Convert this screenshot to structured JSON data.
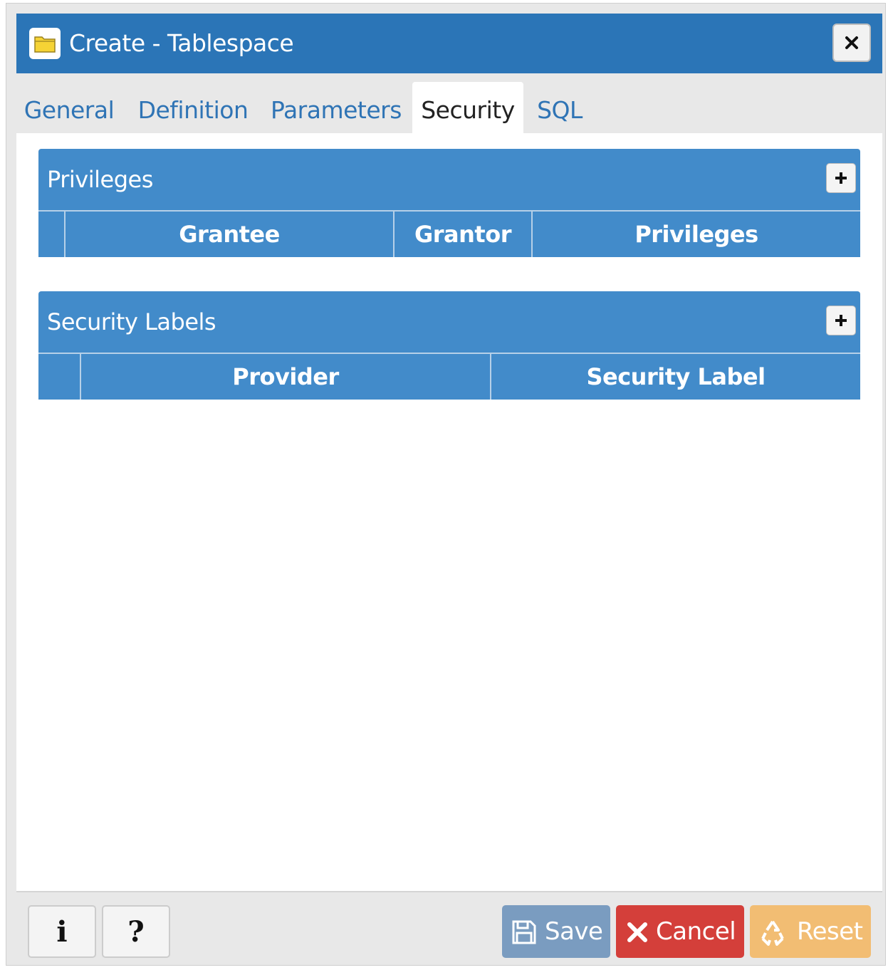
{
  "dialog": {
    "title": "Create - Tablespace",
    "title_icon": "folder-icon",
    "close_icon": "close-icon"
  },
  "tabs": [
    {
      "label": "General",
      "active": false
    },
    {
      "label": "Definition",
      "active": false
    },
    {
      "label": "Parameters",
      "active": false
    },
    {
      "label": "Security",
      "active": true
    },
    {
      "label": "SQL",
      "active": false
    }
  ],
  "privileges": {
    "title": "Privileges",
    "add_icon": "plus-icon",
    "columns": [
      "Grantee",
      "Grantor",
      "Privileges"
    ]
  },
  "security_labels": {
    "title": "Security Labels",
    "add_icon": "plus-icon",
    "columns": [
      "Provider",
      "Security Label"
    ]
  },
  "footer": {
    "info_glyph": "i",
    "help_glyph": "?",
    "save_label": "Save",
    "cancel_label": "Cancel",
    "reset_label": "Reset"
  },
  "colors": {
    "titlebar": "#2b75b7",
    "panel": "#428bca",
    "tab_link": "#2f74b5",
    "save": "#7a9cc0",
    "cancel": "#d43f3a",
    "reset": "#f2bd73"
  }
}
